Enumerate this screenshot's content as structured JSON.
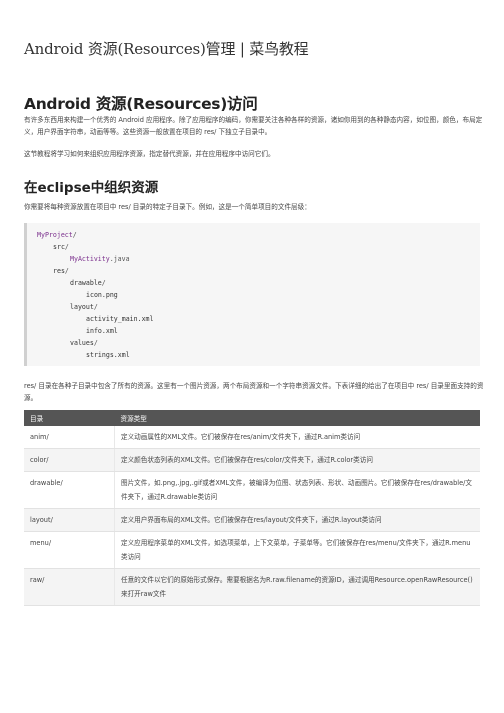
{
  "doc_title": "Android 资源(Resources)管理 | 菜鸟教程",
  "section1": {
    "heading": "Android 资源(Resources)访问",
    "para1": "有许多东西用来构建一个优秀的 Android 应用程序。除了应用程序的编码，你需要关注各种各样的资源，诸如你用到的各种静态内容，如位图，颜色，布局定义，用户界面字符串，动画等等。这些资源一般放置在项目的 res/ 下独立子目录中。",
    "para2": "这节教程将学习如何来组织应用程序资源，指定替代资源，并在应用程序中访问它们。"
  },
  "section2": {
    "heading": "在eclipse中组织资源",
    "para": "你需要将每种资源放置在项目中 res/ 目录的特定子目录下。例如，这是一个简单项目的文件层级："
  },
  "code_lines": [
    {
      "name": "MyProject",
      "punc": "/"
    },
    {
      "name": "src",
      "punc": "/"
    },
    {
      "name": "MyActivity",
      "punc": ".java"
    },
    {
      "name": "res",
      "punc": "/"
    },
    {
      "name": "drawable",
      "punc": "/"
    },
    {
      "name": "icon.png",
      "punc": ""
    },
    {
      "name": "layout",
      "punc": "/"
    },
    {
      "name": "activity_main.xml",
      "punc": ""
    },
    {
      "name": "info.xml",
      "punc": ""
    },
    {
      "name": "values",
      "punc": "/"
    },
    {
      "name": "strings.xml",
      "punc": ""
    }
  ],
  "para_table_intro": "res/ 目录在各种子目录中包含了所有的资源。这里有一个图片资源，两个布局资源和一个字符串资源文件。下表详细的给出了在项目中 res/ 目录里面支持的资源。",
  "table": {
    "headers": [
      "目录",
      "资源类型"
    ],
    "rows": [
      {
        "dir": "anim/",
        "desc": "定义动画属性的XML文件。它们被保存在res/anim/文件夹下，通过R.anim类访问"
      },
      {
        "dir": "color/",
        "desc": "定义颜色状态列表的XML文件。它们被保存在res/color/文件夹下，通过R.color类访问"
      },
      {
        "dir": "drawable/",
        "desc": "图片文件，如.png,.jpg,.gif或者XML文件，被编译为位图、状态列表、形状、动画图片。它们被保存在res/drawable/文件夹下，通过R.drawable类访问"
      },
      {
        "dir": "layout/",
        "desc": "定义用户界面布局的XML文件。它们被保存在res/layout/文件夹下，通过R.layout类访问"
      },
      {
        "dir": "menu/",
        "desc": "定义应用程序菜单的XML文件，如选项菜单，上下文菜单，子菜单等。它们被保存在res/menu/文件夹下，通过R.menu类访问"
      },
      {
        "dir": "raw/",
        "desc": "任意的文件以它们的原始形式保存。需要根据名为R.raw.filename的资源ID，通过调用Resource.openRawResource()来打开raw文件"
      }
    ]
  }
}
